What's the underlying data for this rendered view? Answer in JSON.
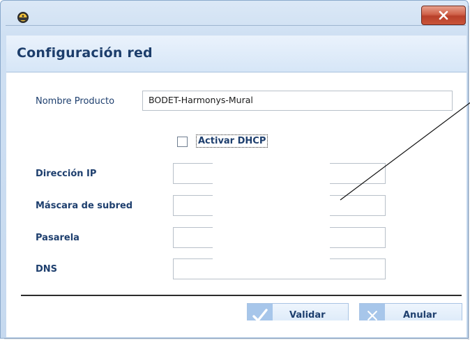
{
  "window": {
    "title": "Configuración red",
    "close_symbol": "x",
    "app_icon": "clock-app-icon"
  },
  "form": {
    "product_name": {
      "label": "Nombre Producto",
      "value": "BODET-Harmonys-Mural"
    },
    "dhcp": {
      "label": "Activar DHCP",
      "checked": false
    },
    "ip": {
      "label": "Dirección IP",
      "value": ""
    },
    "subnet": {
      "label": "Máscara de subred",
      "value": ""
    },
    "gateway": {
      "label": "Pasarela",
      "value": ""
    },
    "dns": {
      "label": "DNS",
      "value": ""
    }
  },
  "buttons": {
    "validate": {
      "label": "Validar",
      "icon": "checkmark-icon"
    },
    "cancel": {
      "label": "Anular",
      "icon": "close-icon"
    }
  },
  "colors": {
    "title_text": "#1c3d6b",
    "label_text": "#1e3f6e",
    "close_button": "#c9543a",
    "button_icon_bg": "#a7c6ea"
  }
}
